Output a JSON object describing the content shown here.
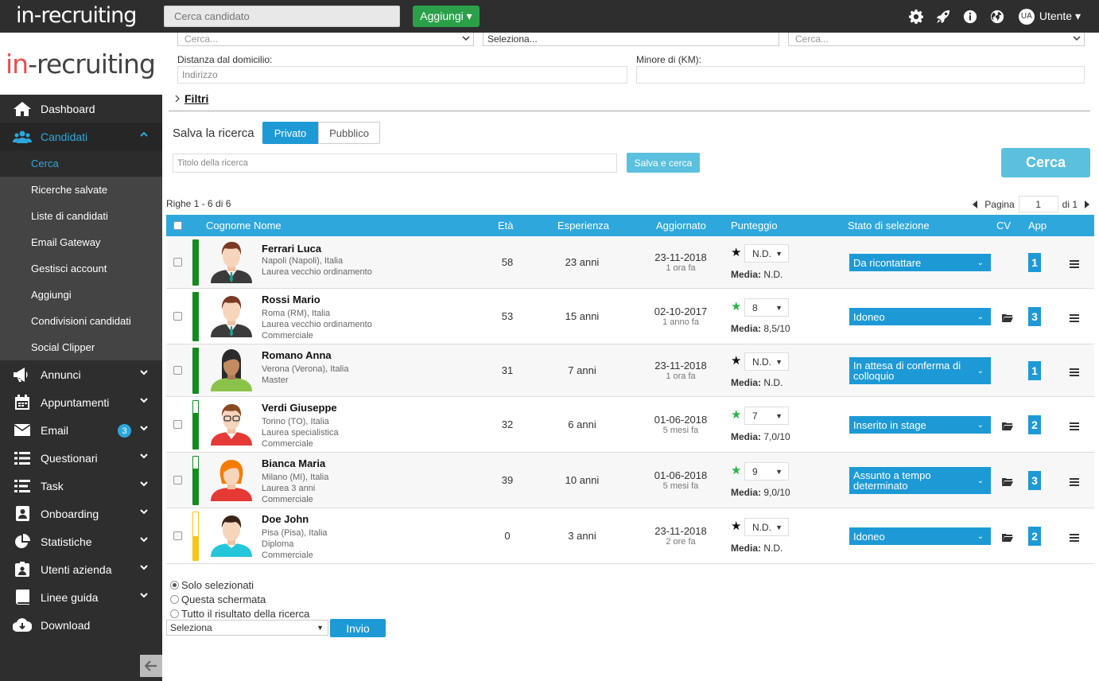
{
  "topbar": {
    "logo": "in-recruiting",
    "search_placeholder": "Cerca candidato",
    "add_button": "Aggiungi ▾",
    "user_initials": "UA",
    "user_label": "Utente ▾"
  },
  "sidebar": {
    "logo": [
      "in",
      "-recruiting"
    ],
    "items": [
      {
        "label": "Dashboard",
        "icon": "home-icon"
      },
      {
        "label": "Candidati",
        "icon": "users-icon"
      },
      {
        "label": "Annunci",
        "icon": "megaphone-icon"
      },
      {
        "label": "Appuntamenti",
        "icon": "calendar-icon"
      },
      {
        "label": "Email",
        "icon": "envelope-icon",
        "badge": "3"
      },
      {
        "label": "Questionari",
        "icon": "list-icon"
      },
      {
        "label": "Task",
        "icon": "tasks-icon"
      },
      {
        "label": "Onboarding",
        "icon": "onboarding-icon"
      },
      {
        "label": "Statistiche",
        "icon": "pie-chart-icon"
      },
      {
        "label": "Utenti azienda",
        "icon": "id-badge-icon"
      },
      {
        "label": "Linee guida",
        "icon": "book-icon"
      },
      {
        "label": "Download",
        "icon": "cloud-download-icon"
      }
    ],
    "subitems": [
      "Cerca",
      "Ricerche salvate",
      "Liste di candidati",
      "Email Gateway",
      "Gestisci account",
      "Aggiungi",
      "Condivisioni candidati",
      "Social Clipper"
    ]
  },
  "filters": {
    "select1": "Cerca...",
    "select2": "Seleziona...",
    "select3": "Cerca...",
    "distance_label": "Distanza dal domicilio:",
    "address_placeholder": "Indirizzo",
    "km_label": "Minore di (KM):",
    "filters_link": "Filtri"
  },
  "save_search": {
    "title": "Salva la ricerca",
    "private": "Privato",
    "public": "Pubblico",
    "title_placeholder": "Titolo della ricerca",
    "save_button": "Salva e cerca",
    "search_button": "Cerca"
  },
  "results": {
    "rows_info": "Righe 1 - 6 di 6",
    "page_label": "Pagina",
    "page_value": "1",
    "page_total": "di 1"
  },
  "table": {
    "headers": {
      "name": "Cognome Nome",
      "age": "Età",
      "exp": "Esperienza",
      "updated": "Aggiornato",
      "score": "Punteggio",
      "status": "Stato di selezione",
      "cv": "CV",
      "app": "App"
    },
    "rows": [
      {
        "name": "Ferrari Luca",
        "details": [
          "Napoli (Napoli), Italia",
          "Laurea vecchio ordinamento"
        ],
        "age": "58",
        "exp": "23 anni",
        "date": "23-11-2018",
        "ago": "1 ora fa",
        "score": "N.D.",
        "star": "black",
        "media": "N.D.",
        "status": "Da ricontattare",
        "app": "1",
        "cv": false,
        "bar_fill": 1.0,
        "avatar": "male-suit"
      },
      {
        "name": "Rossi Mario",
        "details": [
          "Roma (RM), Italia",
          "Laurea vecchio ordinamento",
          "Commerciale"
        ],
        "age": "53",
        "exp": "15 anni",
        "date": "02-10-2017",
        "ago": "1 anno fa",
        "score": "8",
        "star": "green",
        "media": "8,5/10",
        "status": "Idoneo",
        "app": "3",
        "cv": true,
        "bar_fill": 1.0,
        "avatar": "male-suit"
      },
      {
        "name": "Romano Anna",
        "details": [
          "Verona (Verona), Italia",
          "Master"
        ],
        "age": "31",
        "exp": "7 anni",
        "date": "23-11-2018",
        "ago": "1 ora fa",
        "score": "N.D.",
        "star": "black",
        "media": "N.D.",
        "status": "In attesa di conferma di colloquio",
        "app": "1",
        "cv": false,
        "bar_fill": 1.0,
        "avatar": "female-dark"
      },
      {
        "name": "Verdi Giuseppe",
        "details": [
          "Torino (TO), Italia",
          "Laurea specialistica",
          "Commerciale"
        ],
        "age": "32",
        "exp": "6 anni",
        "date": "01-06-2018",
        "ago": "5 mesi fa",
        "score": "7",
        "star": "green",
        "media": "7,0/10",
        "status": "Inserito in stage",
        "app": "2",
        "cv": true,
        "bar_fill": 0.75,
        "avatar": "male-glasses"
      },
      {
        "name": "Bianca Maria",
        "details": [
          "Milano (MI), Italia",
          "Laurea 3 anni",
          "Commerciale"
        ],
        "age": "39",
        "exp": "10 anni",
        "date": "01-06-2018",
        "ago": "5 mesi fa",
        "score": "9",
        "star": "green",
        "media": "9,0/10",
        "status": "Assunto a tempo determinato",
        "app": "3",
        "cv": true,
        "bar_fill": 0.75,
        "avatar": "female-red"
      },
      {
        "name": "Doe John",
        "details": [
          "Pisa (Pisa), Italia",
          "Diploma",
          "Commerciale"
        ],
        "age": "0",
        "exp": "3 anni",
        "date": "23-11-2018",
        "ago": "2 ore fa",
        "score": "N.D.",
        "star": "black",
        "media": "N.D.",
        "status": "Idoneo",
        "app": "2",
        "cv": true,
        "bar_fill": 0.5,
        "bar_color": "#f5c518",
        "avatar": "male-teal"
      }
    ],
    "media_label": "Media:"
  },
  "bulk": {
    "options": [
      "Solo selezionati",
      "Questa schermata",
      "Tutto il risultato della ricerca"
    ],
    "select": "Seleziona",
    "send": "Invio"
  }
}
